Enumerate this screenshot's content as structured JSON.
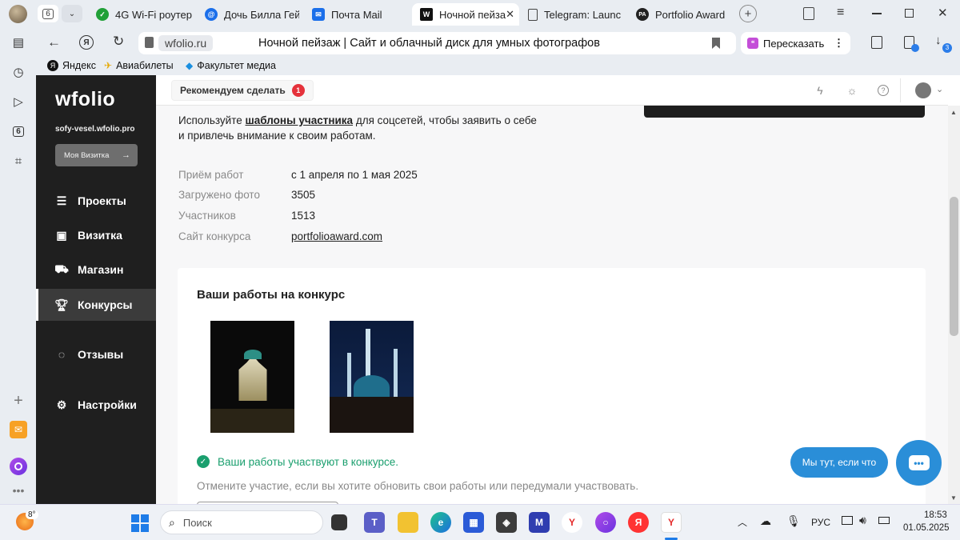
{
  "browser": {
    "tab_count": "6",
    "tabs": [
      {
        "label": "4G Wi-Fi роутер"
      },
      {
        "label": "Дочь Билла Гейт"
      },
      {
        "label": "Почта Mail"
      },
      {
        "label": "Ночной пейза"
      },
      {
        "label": "Telegram: Launc"
      },
      {
        "label": "Portfolio Award"
      }
    ],
    "portfolio_tab_icon_text": "PA",
    "url": "wfolio.ru",
    "page_title": "Ночной пейзаж | Сайт и облачный диск для умных фотографов",
    "retell_label": "Пересказать",
    "downloads_badge": "3",
    "rail_tab_badge": "6",
    "bookmarks": [
      {
        "label": "Яндекс"
      },
      {
        "label": "Авиабилеты"
      },
      {
        "label": "Факультет медиа"
      }
    ]
  },
  "sidebar": {
    "logo": "wfolio",
    "site": "sofy-vesel.wfolio.pro",
    "vizitka_button": "Моя Визитка",
    "nav": [
      {
        "label": "Проекты"
      },
      {
        "label": "Визитка"
      },
      {
        "label": "Магазин"
      },
      {
        "label": "Конкурсы"
      },
      {
        "label": "Отзывы"
      },
      {
        "label": "Настройки"
      }
    ]
  },
  "topbar": {
    "recommend_label": "Рекомендуем сделать",
    "recommend_badge": "1"
  },
  "content": {
    "intro_prefix": "Используйте ",
    "intro_link": "шаблоны участника",
    "intro_suffix": " для соцсетей, чтобы заявить о себе",
    "intro_line2": "и привлечь внимание к своим работам.",
    "info": [
      {
        "label": "Приём работ",
        "value": "с 1 апреля по 1 мая 2025"
      },
      {
        "label": "Загружено фото",
        "value": "3505"
      },
      {
        "label": "Участников",
        "value": "1513"
      },
      {
        "label": "Сайт конкурса",
        "value": "portfolioaward.com"
      }
    ],
    "card_title": "Ваши работы на конкурс",
    "status_text": "Ваши работы участвуют в конкурсе.",
    "hint_text": "Отмените участие, если вы хотите обновить свои работы или передумали участвовать."
  },
  "chat": {
    "bubble": "Мы тут, если что"
  },
  "taskbar": {
    "weather": "8°",
    "search_placeholder": "Поиск",
    "lang": "РУС",
    "time": "18:53",
    "date": "01.05.2025"
  },
  "colors": {
    "accent_green": "#1a9f6e",
    "badge_red": "#e5323b",
    "chat_blue": "#2a8ed8",
    "sidebar_bg": "#1f1f1f"
  }
}
